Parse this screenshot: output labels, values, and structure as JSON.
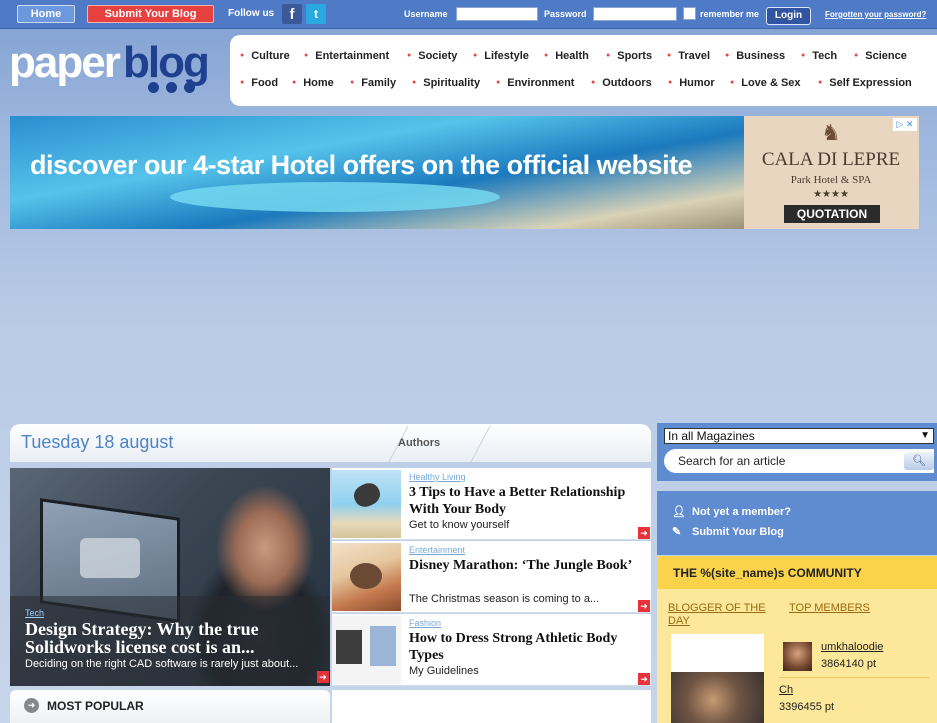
{
  "topbar": {
    "home": "Home",
    "submit": "Submit Your Blog",
    "follow": "Follow us",
    "facebook_glyph": "f",
    "twitter_glyph": "t",
    "username_label": "Username",
    "password_label": "Password",
    "remember": "remember me",
    "login": "Login",
    "forgot": "Forgotten your password?"
  },
  "logo": {
    "part1": "paper",
    "part2": "blog"
  },
  "categories": {
    "row1": [
      "Culture",
      "Entertainment",
      "Society",
      "Lifestyle",
      "Health",
      "Sports",
      "Travel",
      "Business",
      "Tech",
      "Science"
    ],
    "row2": [
      "Food",
      "Home",
      "Family",
      "Spirituality",
      "Environment",
      "Outdoors",
      "Humor",
      "Love & Sex",
      "Self Expression"
    ]
  },
  "ad": {
    "headline": "discover our 4-star Hotel offers on the official website",
    "hotel": "CALA DI LEPRE",
    "sub": "Park Hotel & SPA",
    "stars": "★★★★",
    "button": "QUOTATION",
    "choices": "▷ ✕"
  },
  "date_bar": {
    "date": "Tuesday 18 august",
    "authors": "Authors"
  },
  "feature": {
    "category": "Tech",
    "title": "Design Strategy: Why the true Solidworks license cost is an...",
    "desc": "Deciding on the right CAD software is rarely just about..."
  },
  "articles": [
    {
      "category": "Healthy Living",
      "title": "3 Tips to Have a Better Relationship With Your Body",
      "desc": "Get to know yourself"
    },
    {
      "category": "Entertainment",
      "title": "Disney Marathon: ‘The Jungle Book’",
      "desc": "The Christmas season is coming to a..."
    },
    {
      "category": "Fashion",
      "title": "How to Dress Strong Athletic Body Types",
      "desc": "My Guidelines"
    }
  ],
  "popular": {
    "label": "MOST POPULAR"
  },
  "sidebar": {
    "magazine_select": "In all Magazines",
    "search_placeholder": "Search for an article",
    "not_member": "Not yet a member?",
    "submit_blog": "Submit Your Blog",
    "community_title": "THE %(site_name)s COMMUNITY",
    "blogger_of_day": "BLOGGER OF THE DAY",
    "top_members": "TOP MEMBERS",
    "members": [
      {
        "name": "umkhaloodie",
        "points": "3864140 pt"
      },
      {
        "name": "Ch",
        "points": "3396455 pt"
      }
    ]
  },
  "colors": {
    "topbar": "#4f7bc6",
    "accent_red": "#e74646",
    "brand_blue": "#1f3f8f",
    "community_yellow": "#fbd34b"
  }
}
